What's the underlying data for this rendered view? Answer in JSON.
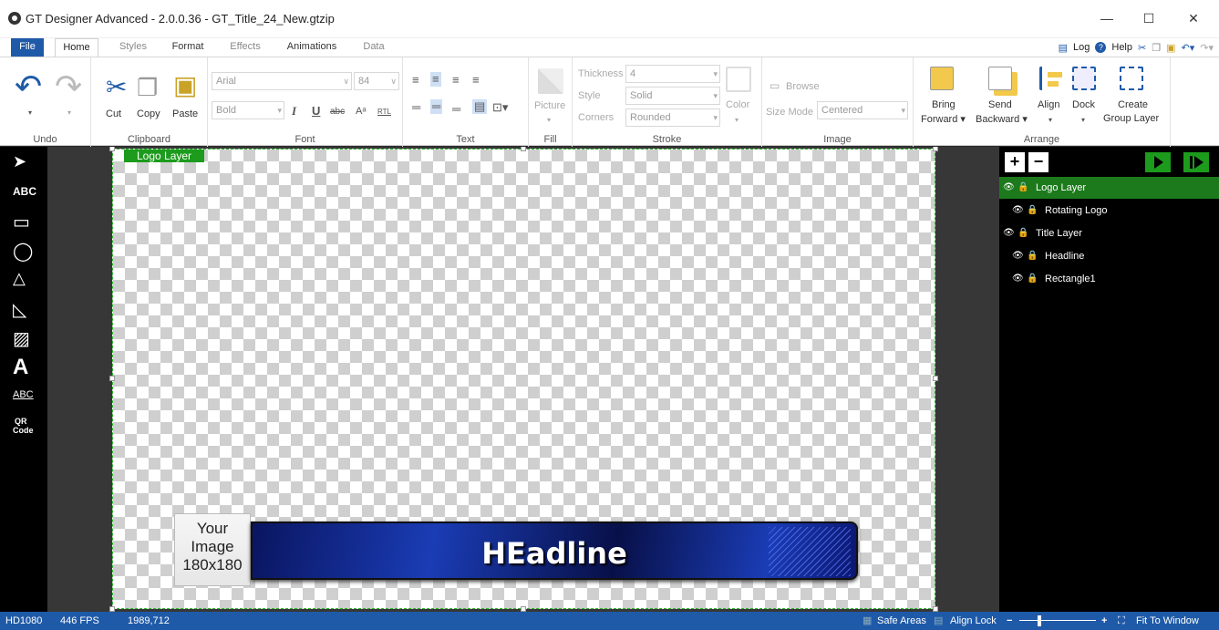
{
  "window": {
    "title": "GT Designer Advanced - 2.0.0.36 - GT_Title_24_New.gtzip",
    "minimize": "—",
    "maximize": "☐",
    "close": "✕"
  },
  "menu": {
    "tabs": [
      "File",
      "Home",
      "Styles",
      "Format",
      "Effects",
      "Animations",
      "Data"
    ],
    "active": "Home",
    "log": "Log",
    "help": "Help"
  },
  "ribbon": {
    "undo": {
      "label": "Undo"
    },
    "clipboard": {
      "cut": "Cut",
      "copy": "Copy",
      "paste": "Paste",
      "label": "Clipboard"
    },
    "font": {
      "family": "Arial",
      "size": "84",
      "weight": "Bold",
      "label": "Font",
      "italic": "I",
      "underline": "U",
      "strike": "abc",
      "caps": "Aᵃ",
      "rtl": "RTL"
    },
    "text": {
      "label": "Text"
    },
    "fill": {
      "picture": "Picture",
      "label": "Fill"
    },
    "stroke": {
      "thickness_label": "Thickness",
      "thickness": "4",
      "style_label": "Style",
      "style": "Solid",
      "corners_label": "Corners",
      "corners": "Rounded",
      "color": "Color",
      "label": "Stroke"
    },
    "image": {
      "browse": "Browse",
      "size_mode_label": "Size Mode",
      "size_mode": "Centered",
      "label": "Image"
    },
    "arrange": {
      "bring_forward_1": "Bring",
      "bring_forward_2": "Forward ▾",
      "send_backward_1": "Send",
      "send_backward_2": "Backward ▾",
      "align": "Align",
      "dock": "Dock",
      "create_group_1": "Create",
      "create_group_2": "Group Layer",
      "label": "Arrange"
    }
  },
  "tools": {
    "text": "ABC",
    "qr": "QR",
    "qr2": "Code",
    "text_path": "ABC"
  },
  "canvas": {
    "layer_tag": "Logo Layer",
    "image_placeholder": [
      "Your",
      "Image",
      "180x180"
    ],
    "headline": "HEadline"
  },
  "layers": [
    {
      "name": "Logo Layer",
      "selected": true,
      "indent": 0
    },
    {
      "name": "Rotating Logo",
      "selected": false,
      "indent": 1
    },
    {
      "name": "Title Layer",
      "selected": false,
      "indent": 0
    },
    {
      "name": "Headline",
      "selected": false,
      "indent": 1
    },
    {
      "name": "Rectangle1",
      "selected": false,
      "indent": 1
    }
  ],
  "status": {
    "format": "HD1080",
    "fps": "446 FPS",
    "coords": "1989,712",
    "safe_areas": "Safe Areas",
    "align_lock": "Align Lock",
    "fit": "Fit To Window"
  },
  "colors": {
    "accent": "#1f5aa8",
    "selected": "#1c7a1c",
    "green": "#1c9b1c"
  }
}
